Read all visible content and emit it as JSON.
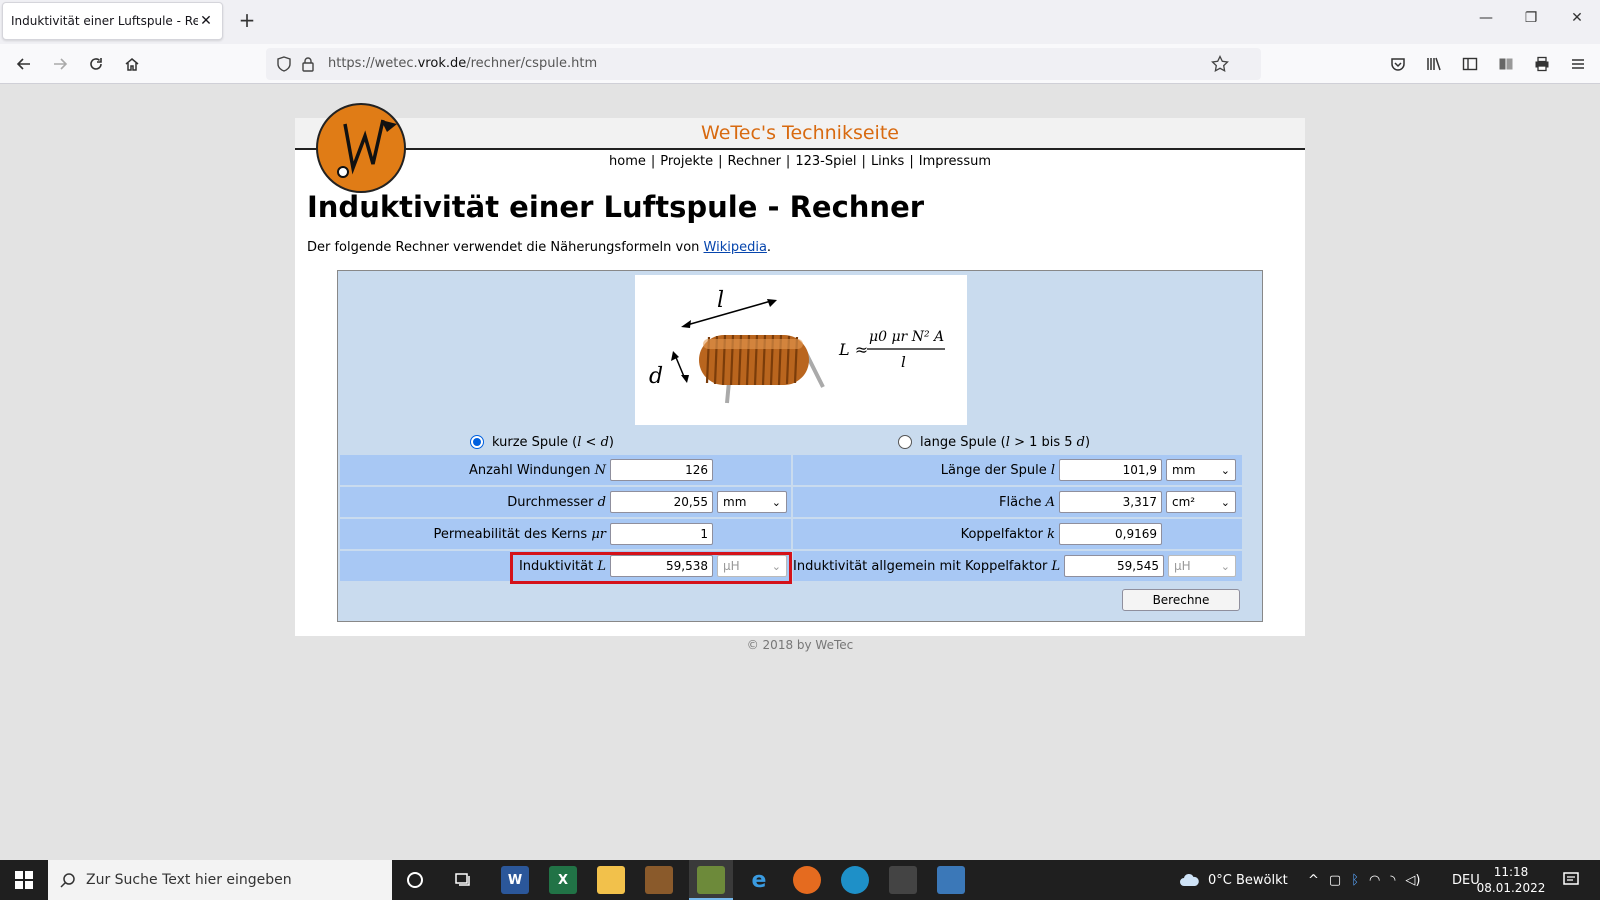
{
  "browser": {
    "tab_title": "Induktivität einer Luftspule - Rechner",
    "tab_close": "✕",
    "new_tab": "+",
    "url_prefix": "https://wetec.",
    "url_domain": "vrok.de",
    "url_path": "/rechner/cspule.htm",
    "window_controls": {
      "minimize": "—",
      "restore": "❐",
      "close": "✕"
    }
  },
  "site": {
    "title": "WeTec's Technikseite",
    "nav": [
      "home",
      "Projekte",
      "Rechner",
      "123-Spiel",
      "Links",
      "Impressum"
    ],
    "nav_separator": "|",
    "heading": "Induktivität einer Luftspule - Rechner",
    "intro_text": "Der folgende Rechner verwendet die Näherungsformeln von ",
    "intro_link": "Wikipedia",
    "intro_end": ".",
    "copyright": "© 2018 by WeTec"
  },
  "diagram": {
    "label_l": "l",
    "label_d": "d",
    "formula_lhs": "L ≈",
    "formula_num": "μ0 μr N² A",
    "formula_den": "l"
  },
  "calculator": {
    "radio_short": {
      "label": "kurze Spule (",
      "var1": "l",
      "op": " < ",
      "var2": "d",
      "end": ")",
      "checked": true
    },
    "radio_long": {
      "label": "lange Spule (",
      "var1": "l",
      "op": " > 1 bis 5 ",
      "var2": "d",
      "end": ")",
      "checked": false
    },
    "left": {
      "windings_label": "Anzahl Windungen ",
      "windings_var": "N",
      "windings_value": "126",
      "diameter_label": "Durchmesser ",
      "diameter_var": "d",
      "diameter_value": "20,55",
      "diameter_unit": "mm",
      "perm_label": "Permeabilität des Kerns ",
      "perm_var": "μr",
      "perm_value": "1",
      "ind_label": "Induktivität ",
      "ind_var": "L",
      "ind_value": "59,538",
      "ind_unit": "µH"
    },
    "right": {
      "length_label": "Länge der Spule ",
      "length_var": "l",
      "length_value": "101,9",
      "length_unit": "mm",
      "area_label": "Fläche ",
      "area_var": "A",
      "area_value": "3,317",
      "area_unit": "cm²",
      "coupling_label": "Koppelfaktor ",
      "coupling_var": "k",
      "coupling_value": "0,9169",
      "ind_label": "Induktivität allgemein mit Koppelfaktor ",
      "ind_var": "L",
      "ind_value": "59,545",
      "ind_unit": "µH"
    },
    "button": "Berechne"
  },
  "taskbar": {
    "search_placeholder": "Zur Suche Text hier eingeben",
    "weather": "0°C  Bewölkt",
    "lang": "DEU",
    "time": "11:18",
    "date": "08.01.2022"
  },
  "colors": {
    "accent_orange": "#d86a10",
    "table_blue": "#a8c8f4",
    "calc_bg": "#c9dbee",
    "highlight_red": "#d4121a"
  }
}
